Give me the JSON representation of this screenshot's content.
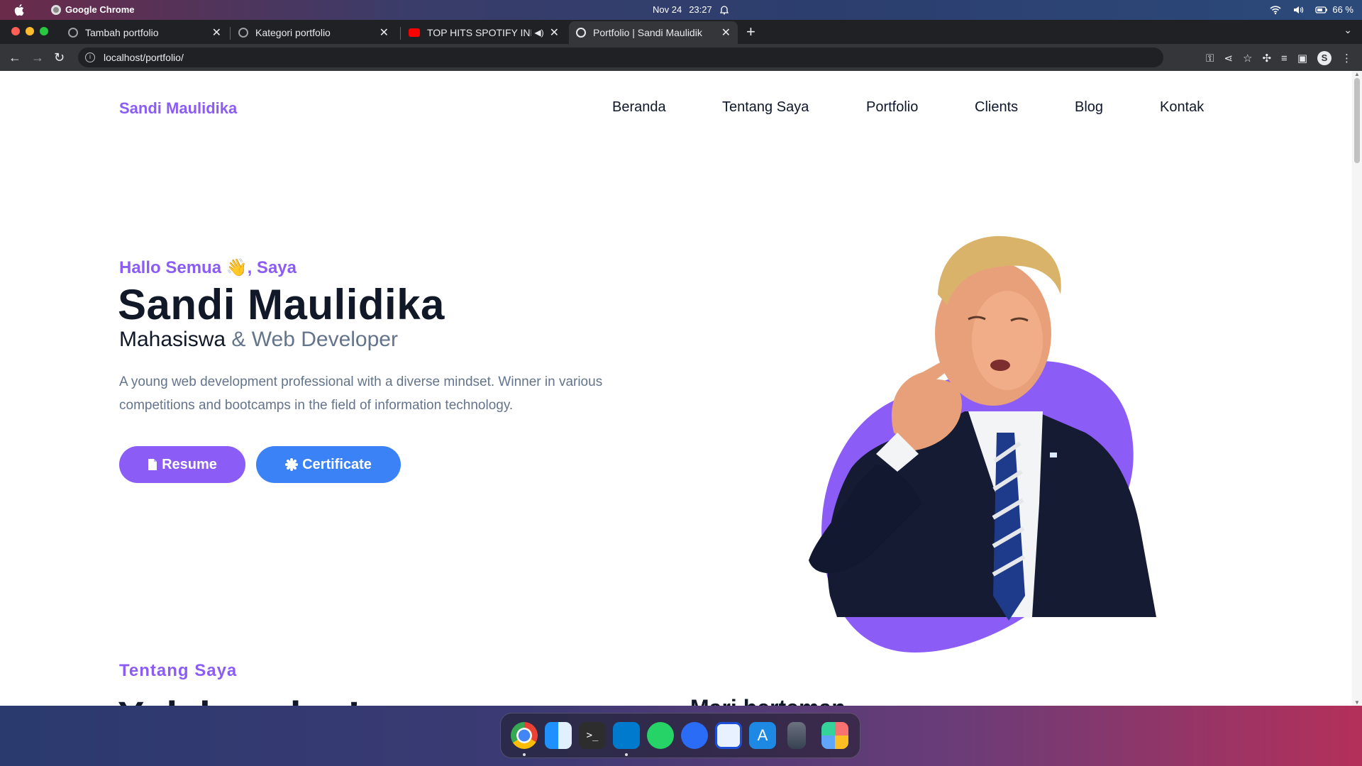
{
  "menubar": {
    "app_name": "Google Chrome",
    "date": "Nov 24",
    "time": "23:27",
    "battery": "66 %",
    "icons": [
      "apple-icon",
      "alarm-icon",
      "wifi-icon",
      "volume-icon",
      "battery-icon"
    ]
  },
  "tabs": [
    {
      "title": "Tambah portfolio",
      "favicon": "globe-icon",
      "active": false
    },
    {
      "title": "Kategori portfolio",
      "favicon": "globe-icon",
      "active": false
    },
    {
      "title": "TOP HITS SPOTIFY IND",
      "favicon": "youtube-icon",
      "active": false,
      "audio": true
    },
    {
      "title": "Portfolio | Sandi Maulidik",
      "favicon": "globe-icon",
      "active": true
    }
  ],
  "toolbar": {
    "url": "localhost/portfolio/",
    "profile_initial": "S"
  },
  "site": {
    "brand": "Sandi Maulidika",
    "nav": [
      "Beranda",
      "Tentang Saya",
      "Portfolio",
      "Clients",
      "Blog",
      "Kontak"
    ],
    "hero": {
      "greeting": "Hallo Semua 👋, Saya",
      "name": "Sandi Maulidika",
      "role_main": "Mahasiswa",
      "role_rest": " & Web Developer",
      "description": "A young web development professional with a diverse mindset. Winner in various competitions and bootcamps in the field of information technology.",
      "btn_resume": "Resume",
      "btn_certificate": "Certificate"
    },
    "about": {
      "label": "Tentang Saya",
      "heading_cut": "Yuk kenalan!",
      "subheading_cut": "Mari berteman"
    }
  },
  "colors": {
    "accent": "#8b5cf6",
    "blue": "#3b82f6",
    "text_dark": "#111827",
    "text_muted": "#64748b"
  },
  "dock": [
    "chrome-icon",
    "finder-icon",
    "terminal-icon",
    "vscode-icon",
    "whatsapp-icon",
    "discord-icon",
    "text-editor-icon",
    "app-store-icon",
    "trash-icon",
    "launchpad-icon"
  ]
}
